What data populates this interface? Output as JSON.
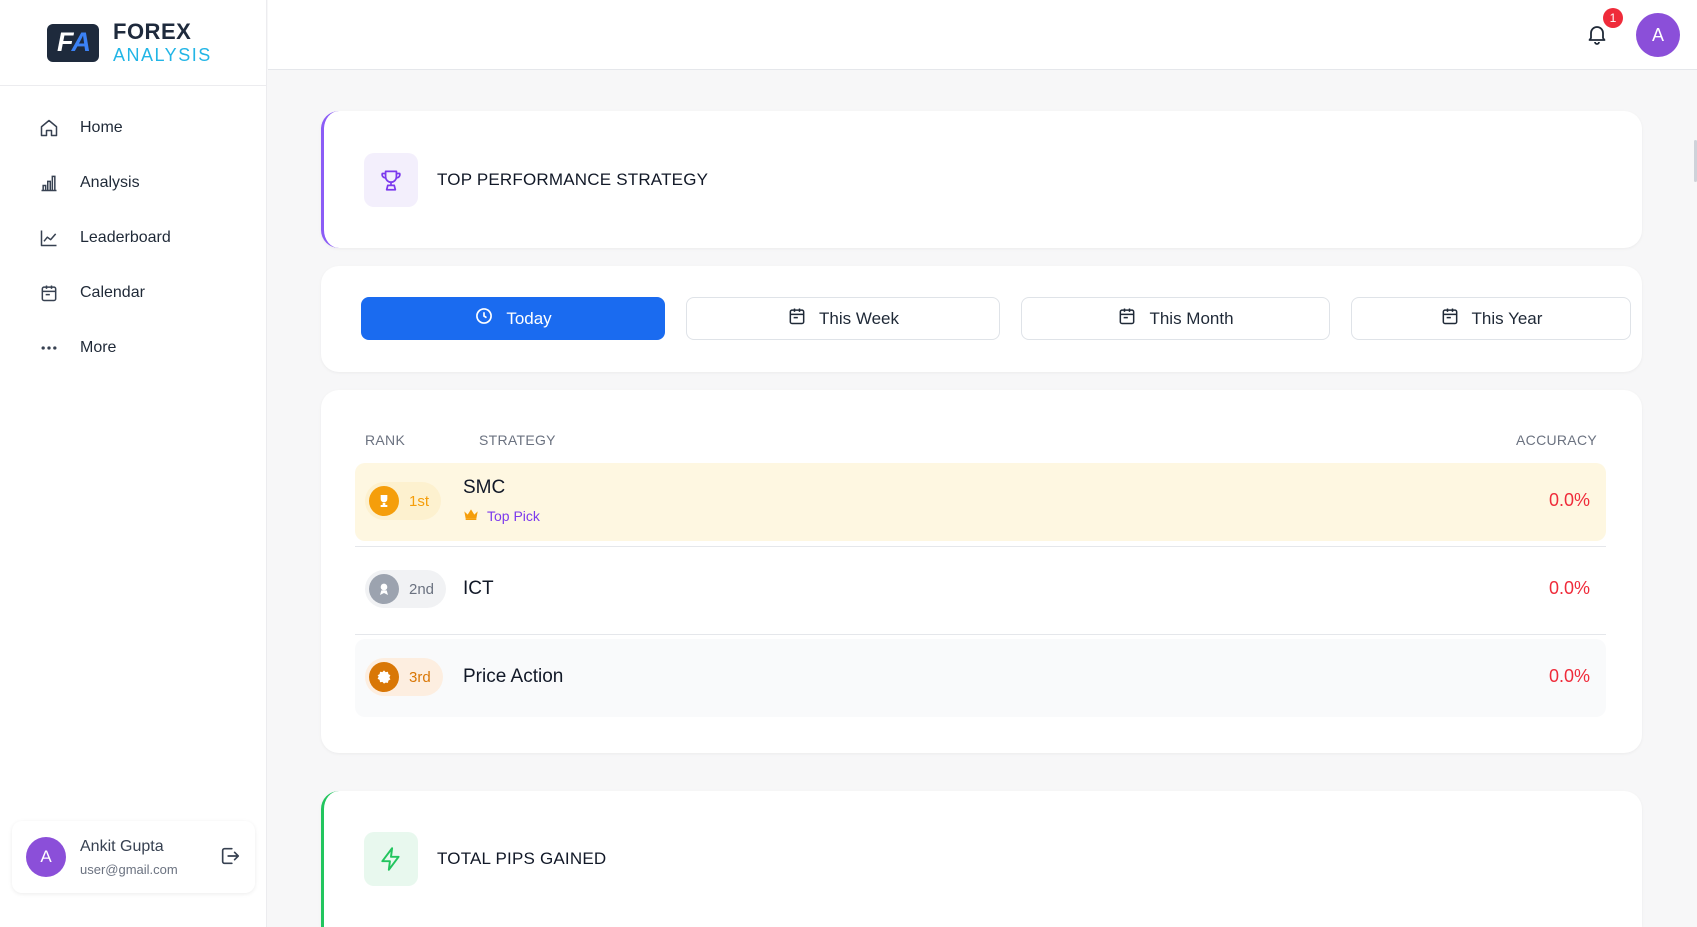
{
  "brand": {
    "line1": "FOREX",
    "line2": "ANALYSIS",
    "logo_f": "F",
    "logo_a": "A"
  },
  "sidebar": {
    "items": [
      {
        "label": "Home",
        "icon": "home-icon"
      },
      {
        "label": "Analysis",
        "icon": "bar-chart-icon"
      },
      {
        "label": "Leaderboard",
        "icon": "line-chart-icon"
      },
      {
        "label": "Calendar",
        "icon": "calendar-icon"
      },
      {
        "label": "More",
        "icon": "more-dots-icon"
      }
    ]
  },
  "user": {
    "initial": "A",
    "name": "Ankit Gupta",
    "email": "user@gmail.com"
  },
  "topbar": {
    "notification_count": "1",
    "avatar_initial": "A"
  },
  "top_strategy": {
    "title": "TOP PERFORMANCE STRATEGY"
  },
  "periods": {
    "tabs": [
      {
        "label": "Today",
        "icon": "clock-icon",
        "active": true
      },
      {
        "label": "This Week",
        "icon": "calendar-icon",
        "active": false
      },
      {
        "label": "This Month",
        "icon": "calendar-icon",
        "active": false
      },
      {
        "label": "This Year",
        "icon": "calendar-icon",
        "active": false
      }
    ]
  },
  "table": {
    "headers": {
      "rank": "RANK",
      "strategy": "STRATEGY",
      "accuracy": "ACCURACY"
    },
    "rows": [
      {
        "rank": "1st",
        "name": "SMC",
        "badge": "Top Pick",
        "accuracy": "0.0%"
      },
      {
        "rank": "2nd",
        "name": "ICT",
        "accuracy": "0.0%"
      },
      {
        "rank": "3rd",
        "name": "Price Action",
        "accuracy": "0.0%"
      }
    ]
  },
  "pips": {
    "title": "TOTAL PIPS GAINED"
  },
  "colors": {
    "primary": "#1a6bf0",
    "accent_purple": "#8b5cf6",
    "accent_green": "#22c55e",
    "gold": "#f59e0b",
    "silver": "#9ca3af",
    "bronze": "#d97706",
    "negative": "#ef2b3a",
    "avatar": "#8b4fd9"
  }
}
